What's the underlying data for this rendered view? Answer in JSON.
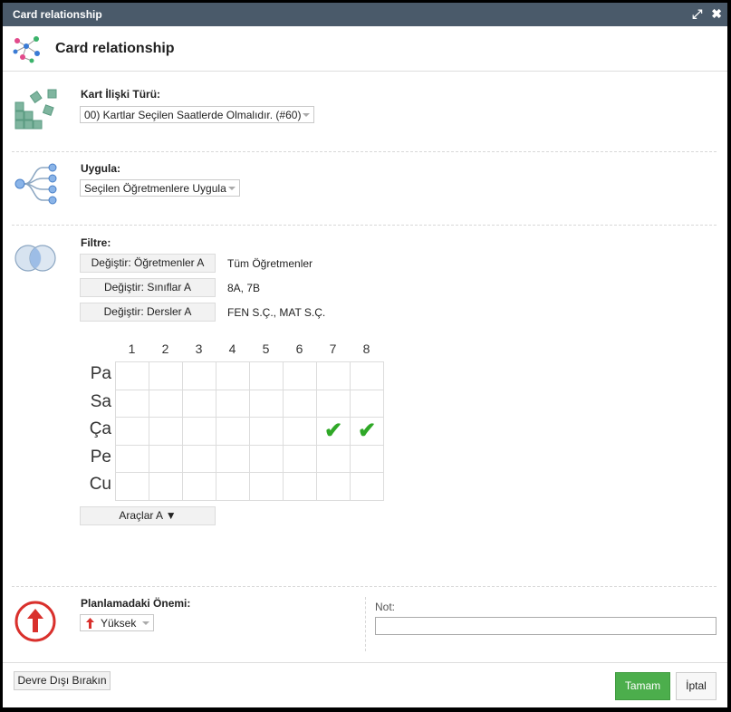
{
  "window": {
    "title": "Card relationship",
    "maximize_icon": "expand-icon",
    "close_icon": "close-icon"
  },
  "header": {
    "title": "Card relationship"
  },
  "relation_type": {
    "label": "Kart İlişki Türü:",
    "value": "00) Kartlar Seçilen Saatlerde Olmalıdır. (#60)"
  },
  "apply": {
    "label": "Uygula:",
    "value": "Seçilen Öğretmenlere Uygula"
  },
  "filter": {
    "label": "Filtre:",
    "rows": [
      {
        "button": "Değiştir: Öğretmenler A",
        "value": "Tüm Öğretmenler"
      },
      {
        "button": "Değiştir: Sınıflar A",
        "value": "8A, 7B"
      },
      {
        "button": "Değiştir: Dersler A",
        "value": "FEN S.Ç., MAT S.Ç."
      }
    ]
  },
  "timetable": {
    "columns": [
      "1",
      "2",
      "3",
      "4",
      "5",
      "6",
      "7",
      "8"
    ],
    "rows": [
      "Pa",
      "Sa",
      "Ça",
      "Pe",
      "Cu"
    ],
    "checked": [
      [
        2,
        6
      ],
      [
        2,
        7
      ]
    ],
    "check_color": "#2fa827"
  },
  "tools_button": "Araçlar A ▼",
  "priority": {
    "label": "Planlamadaki Önemi:",
    "value": "Yüksek",
    "icon": "arrow-up-icon",
    "icon_color": "#d9302c"
  },
  "note": {
    "label": "Not:",
    "value": ""
  },
  "footer": {
    "disable_label": "Devre Dışı Bırakın",
    "ok_label": "Tamam",
    "cancel_label": "İptal",
    "ok_color": "#4cae4c"
  }
}
